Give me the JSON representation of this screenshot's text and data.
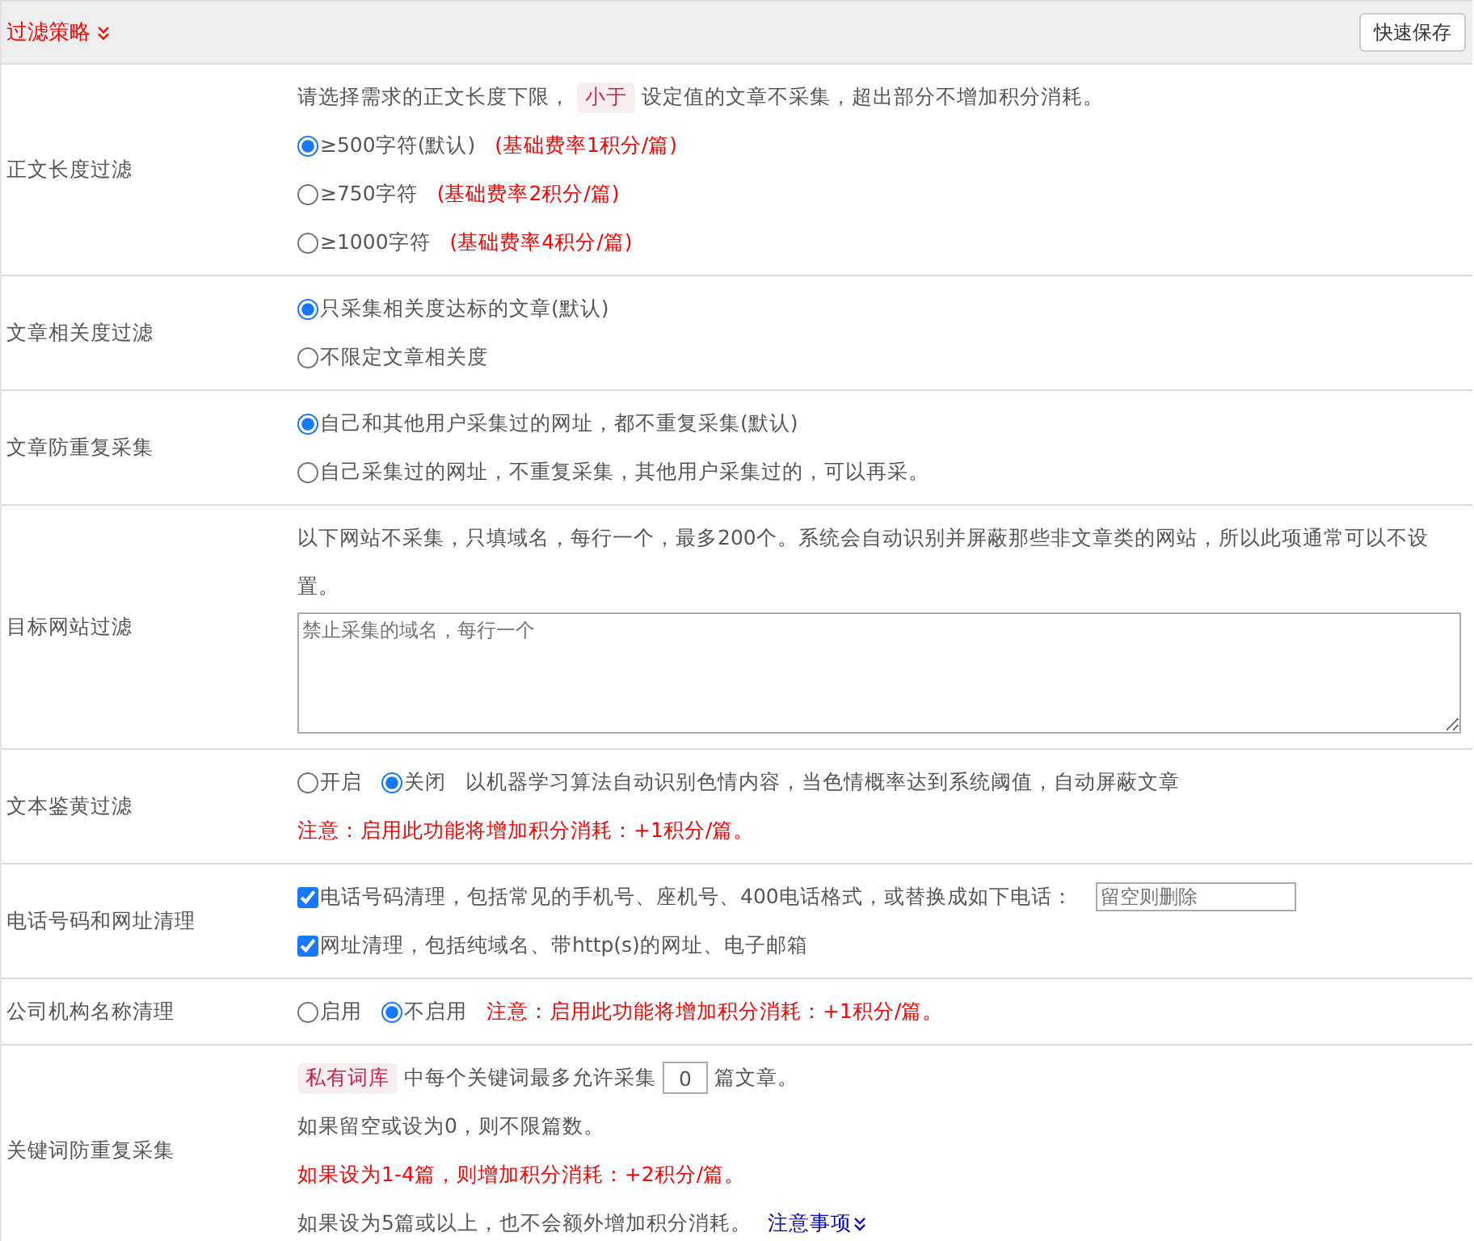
{
  "header": {
    "title": "过滤策略",
    "button": "快速保存"
  },
  "rows": [
    {
      "label": "正文长度过滤",
      "lines": [
        [
          {
            "kind": "text",
            "text": "请选择需求的正文长度下限，"
          },
          {
            "kind": "tag",
            "text": "小于"
          },
          {
            "kind": "text",
            "text": "设定值的文章不采集，超出部分不增加积分消耗。"
          }
        ],
        [
          {
            "kind": "radio",
            "label": "≥500字符(默认)",
            "selected": true
          },
          {
            "kind": "warn",
            "text": "(基础费率1积分/篇)"
          }
        ],
        [
          {
            "kind": "radio",
            "label": "≥750字符",
            "selected": false
          },
          {
            "kind": "warn",
            "text": "(基础费率2积分/篇)"
          }
        ],
        [
          {
            "kind": "radio",
            "label": "≥1000字符",
            "selected": false
          },
          {
            "kind": "warn",
            "text": "(基础费率4积分/篇)"
          }
        ]
      ]
    },
    {
      "label": "文章相关度过滤",
      "lines": [
        [
          {
            "kind": "radio",
            "label": "只采集相关度达标的文章(默认)",
            "selected": true
          }
        ],
        [
          {
            "kind": "radio",
            "label": "不限定文章相关度",
            "selected": false
          }
        ]
      ]
    },
    {
      "label": "文章防重复采集",
      "lines": [
        [
          {
            "kind": "radio",
            "label": "自己和其他用户采集过的网址，都不重复采集(默认)",
            "selected": true
          }
        ],
        [
          {
            "kind": "radio",
            "label": "自己采集过的网址，不重复采集，其他用户采集过的，可以再采。",
            "selected": false
          }
        ]
      ]
    },
    {
      "label": "目标网站过滤",
      "lines": [
        [
          {
            "kind": "text",
            "text": "以下网站不采集，只填域名，每行一个，最多200个。系统会自动识别并屏蔽那些非文章类的网站，所以此项通常可以不设置。"
          }
        ],
        [
          {
            "kind": "textarea",
            "placeholder": "禁止采集的域名，每行一个"
          }
        ]
      ]
    },
    {
      "label": "文本鉴黄过滤",
      "lines": [
        [
          {
            "kind": "radio",
            "label": "开启",
            "selected": false
          },
          {
            "kind": "radio",
            "label": "关闭",
            "selected": true
          },
          {
            "kind": "text",
            "text": "以机器学习算法自动识别色情内容，当色情概率达到系统阈值，自动屏蔽文章"
          }
        ],
        [
          {
            "kind": "warn",
            "text": "注意：启用此功能将增加积分消耗：+1积分/篇。"
          }
        ]
      ]
    },
    {
      "label": "电话号码和网址清理",
      "lines": [
        [
          {
            "kind": "checkbox",
            "label": "电话号码清理，包括常见的手机号、座机号、400电话格式，或替换成如下电话：",
            "checked": true
          },
          {
            "kind": "input",
            "placeholder": "留空则删除"
          }
        ],
        [
          {
            "kind": "checkbox",
            "label": "网址清理，包括纯域名、带http(s)的网址、电子邮箱",
            "checked": true
          }
        ]
      ]
    },
    {
      "label": "公司机构名称清理",
      "lines": [
        [
          {
            "kind": "radio",
            "label": "启用",
            "selected": false
          },
          {
            "kind": "radio",
            "label": "不启用",
            "selected": true
          },
          {
            "kind": "warn",
            "text": "注意：启用此功能将增加积分消耗：+1积分/篇。"
          }
        ]
      ]
    },
    {
      "label": "关键词防重复采集",
      "lines": [
        [
          {
            "kind": "tag",
            "text": "私有词库"
          },
          {
            "kind": "text",
            "text": "中每个关键词最多允许采集"
          },
          {
            "kind": "number",
            "value": "0"
          },
          {
            "kind": "text",
            "text": "篇文章。"
          }
        ],
        [
          {
            "kind": "text",
            "text": "如果留空或设为0，则不限篇数。"
          }
        ],
        [
          {
            "kind": "warn",
            "text": "如果设为1-4篇，则增加积分消耗：+2积分/篇。"
          }
        ],
        [
          {
            "kind": "text",
            "text": "如果设为5篇或以上，也不会额外增加积分消耗。"
          },
          {
            "kind": "link",
            "text": "注意事项"
          }
        ]
      ]
    }
  ]
}
